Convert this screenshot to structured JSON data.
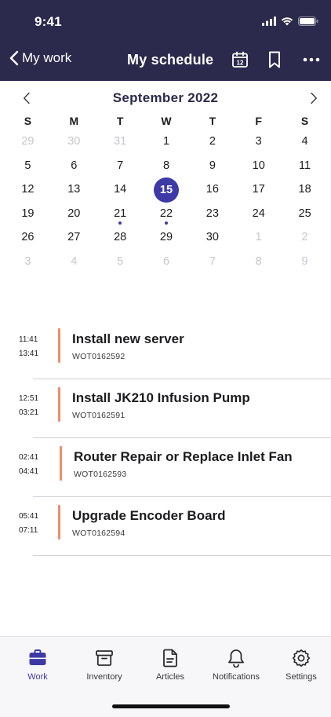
{
  "status_bar": {
    "time": "9:41"
  },
  "nav": {
    "back_label": "My work",
    "title": "My schedule",
    "calendar_badge": "12",
    "icons": [
      "chevron-left-icon",
      "calendar-icon",
      "bookmark-icon",
      "more-icon"
    ]
  },
  "calendar": {
    "month_label": "September 2022",
    "weekdays": [
      "S",
      "M",
      "T",
      "W",
      "T",
      "F",
      "S"
    ],
    "weeks": [
      [
        {
          "d": "29",
          "muted": true
        },
        {
          "d": "30",
          "muted": true
        },
        {
          "d": "31",
          "muted": true
        },
        {
          "d": "1"
        },
        {
          "d": "2"
        },
        {
          "d": "3"
        },
        {
          "d": "4"
        }
      ],
      [
        {
          "d": "5"
        },
        {
          "d": "6"
        },
        {
          "d": "7"
        },
        {
          "d": "8"
        },
        {
          "d": "9"
        },
        {
          "d": "10"
        },
        {
          "d": "11"
        }
      ],
      [
        {
          "d": "12"
        },
        {
          "d": "13"
        },
        {
          "d": "14"
        },
        {
          "d": "15",
          "selected": true
        },
        {
          "d": "16"
        },
        {
          "d": "17"
        },
        {
          "d": "18"
        }
      ],
      [
        {
          "d": "19"
        },
        {
          "d": "20"
        },
        {
          "d": "21",
          "dot": true
        },
        {
          "d": "22",
          "dot": true
        },
        {
          "d": "23"
        },
        {
          "d": "24"
        },
        {
          "d": "25"
        }
      ],
      [
        {
          "d": "26"
        },
        {
          "d": "27"
        },
        {
          "d": "28"
        },
        {
          "d": "29"
        },
        {
          "d": "30"
        },
        {
          "d": "1",
          "muted": true
        },
        {
          "d": "2",
          "muted": true
        }
      ],
      [
        {
          "d": "3",
          "muted": true
        },
        {
          "d": "4",
          "muted": true
        },
        {
          "d": "5",
          "muted": true
        },
        {
          "d": "6",
          "muted": true
        },
        {
          "d": "7",
          "muted": true
        },
        {
          "d": "8",
          "muted": true
        },
        {
          "d": "9",
          "muted": true
        }
      ]
    ]
  },
  "tasks": [
    {
      "start": "11:41",
      "end": "13:41",
      "title": "Install new server",
      "code": "WOT0162592"
    },
    {
      "start": "12:51",
      "end": "03:21",
      "title": "Install JK210 Infusion Pump",
      "code": "WOT0162591"
    },
    {
      "start": "02:41",
      "end": "04:41",
      "title": "Router Repair or Replace Inlet Fan",
      "code": "WOT0162593"
    },
    {
      "start": "05:41",
      "end": "07:11",
      "title": "Upgrade Encoder Board",
      "code": "WOT0162594"
    }
  ],
  "tabbar": {
    "items": [
      {
        "label": "Work",
        "icon": "briefcase-icon",
        "active": true
      },
      {
        "label": "Inventory",
        "icon": "archive-box-icon"
      },
      {
        "label": "Articles",
        "icon": "document-icon"
      },
      {
        "label": "Notifications",
        "icon": "bell-icon"
      },
      {
        "label": "Settings",
        "icon": "gear-icon"
      }
    ]
  },
  "colors": {
    "header_bg": "#2b2a4c",
    "accent": "#3d3aa8",
    "task_bar": "#ef8d6c",
    "muted_day": "#c6c6cc"
  }
}
